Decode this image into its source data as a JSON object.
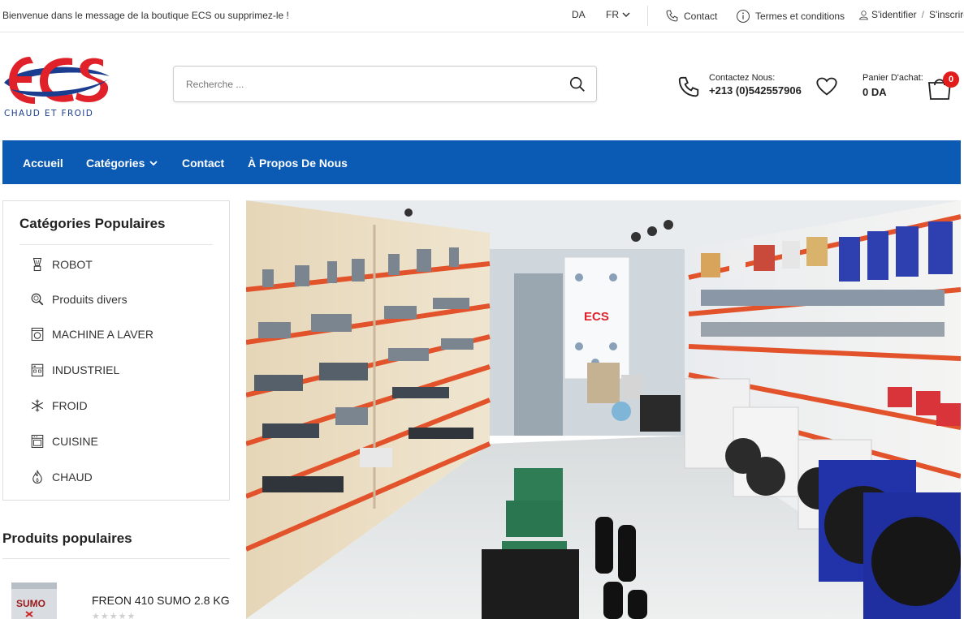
{
  "topbar": {
    "welcome": "Bienvenue dans le message de la boutique ECS ou supprimez-le !",
    "currency": "DA",
    "language": "FR",
    "contact": "Contact",
    "terms": "Termes et conditions",
    "login": "S'identifier",
    "register": "S'inscrire"
  },
  "brand": {
    "logo_text": "ECS",
    "tagline": "CHAUD ET FROID",
    "colors": {
      "blue": "#1a3d8f",
      "red": "#e0212a"
    }
  },
  "search": {
    "placeholder": "Recherche ..."
  },
  "header": {
    "contact_label": "Contactez Nous:",
    "phone": "+213 (0)542557906",
    "cart_label": "Panier D'achat:",
    "cart_total": "0 DA",
    "cart_count": "0"
  },
  "nav": {
    "home": "Accueil",
    "categories": "Catégories",
    "contact": "Contact",
    "about": "À Propos De Nous",
    "color": "#0b5bb5"
  },
  "sidebar": {
    "title": "Catégories Populaires",
    "categories": [
      {
        "label": "ROBOT",
        "icon": "blender-icon"
      },
      {
        "label": "Produits divers",
        "icon": "magnifier-icon"
      },
      {
        "label": "MACHINE A LAVER",
        "icon": "washing-machine-icon"
      },
      {
        "label": "INDUSTRIEL",
        "icon": "factory-icon"
      },
      {
        "label": "FROID",
        "icon": "snowflake-icon"
      },
      {
        "label": "CUISINE",
        "icon": "oven-icon"
      },
      {
        "label": "CHAUD",
        "icon": "flame-icon"
      }
    ],
    "popular_title": "Produits populaires",
    "popular_products": [
      {
        "name": "FREON 410 SUMO 2.8 KG",
        "thumb_text": "SUMO",
        "rating": 0
      }
    ]
  },
  "hero": {
    "description": "store interior photo",
    "logo_text": "ECS"
  }
}
